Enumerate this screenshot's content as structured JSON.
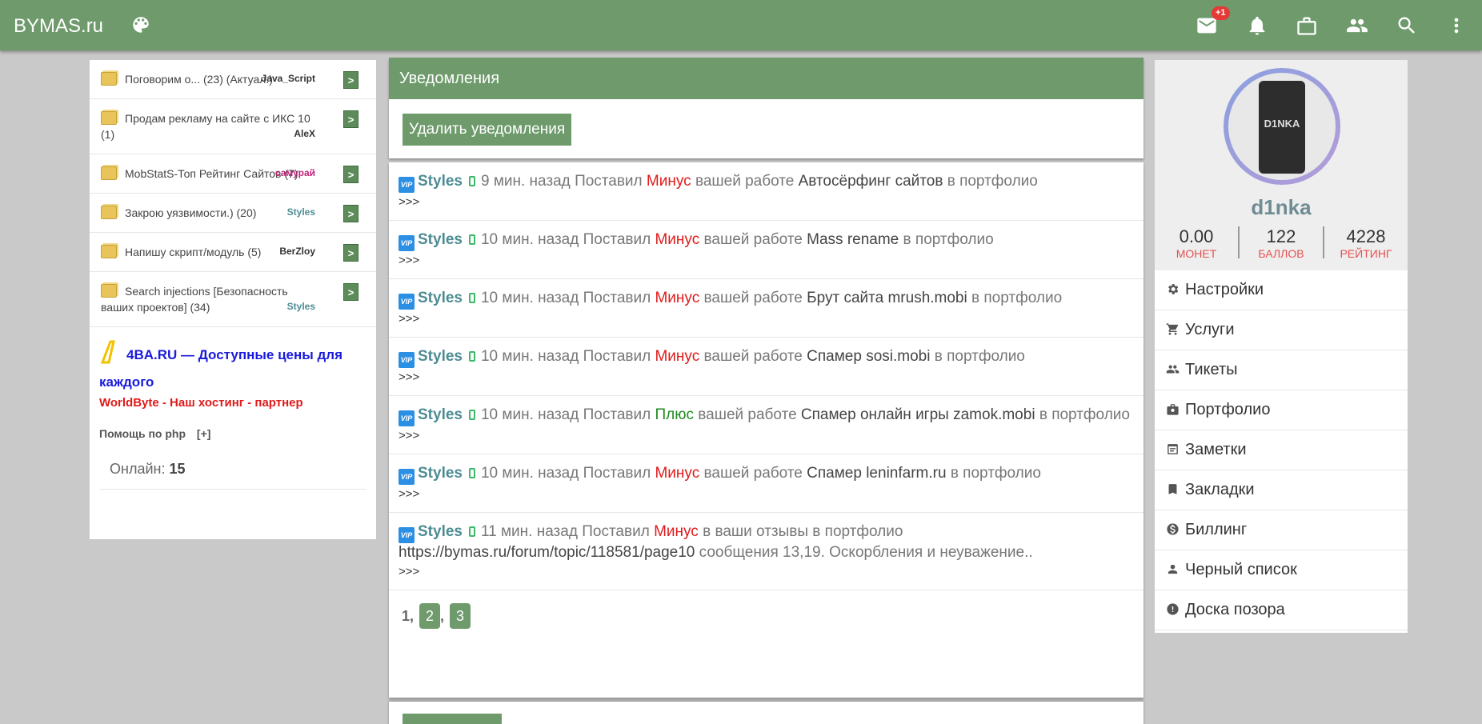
{
  "header": {
    "brand": "BYMAS.ru",
    "mail_badge": "+1",
    "icons": [
      "palette-icon",
      "mail-icon",
      "bell-icon",
      "briefcase-icon",
      "people-icon",
      "search-icon",
      "more-vert-icon"
    ]
  },
  "left": {
    "topics": [
      {
        "title": "Поговорим о... (23) (Актуал.)",
        "author": "Java_Script",
        "author_color": "#333333",
        "go": ">"
      },
      {
        "title": "Продам рекламу на сайте с ИКС 10 (1)",
        "author": "AleX",
        "author_color": "#333333",
        "go": ">"
      },
      {
        "title": "MobStatS-Топ Рейтинг Сайтов (7)",
        "author": "самурай",
        "author_color": "#c0237a",
        "go": ">"
      },
      {
        "title": "Закрою уязвимости.) (20)",
        "author": "Styles",
        "author_color": "#4e8c94",
        "go": ">"
      },
      {
        "title": "Напишу скрипт/модуль (5)",
        "author": "BerZloy",
        "author_color": "#333333",
        "go": ">"
      },
      {
        "title": "Search injections [Безопасность ваших проектов] (34)",
        "author": "Styles",
        "author_color": "#4e8c94",
        "go": ">"
      }
    ],
    "promo_line1": "4BA.RU — Доступные цены для каждого",
    "promo_line2": "WorldByte - Наш хостинг - партнер",
    "help_text": "Помощь по php",
    "help_plus": "[+]",
    "online_label": "Онлайн:",
    "online_count": "15"
  },
  "main": {
    "title": "Уведомления",
    "delete_button": "Удалить уведомления",
    "notifications": [
      {
        "user": "Styles",
        "time": "9 мин. назад",
        "verb": "Поставил",
        "action": "Минус",
        "action_type": "minus",
        "pre": "вашей работе",
        "work": "Автосёрфинг сайтов",
        "post": "в портфолио",
        "more": ">>>"
      },
      {
        "user": "Styles",
        "time": "10 мин. назад",
        "verb": "Поставил",
        "action": "Минус",
        "action_type": "minus",
        "pre": "вашей работе",
        "work": "Mass rename",
        "post": "в портфолио",
        "more": ">>>"
      },
      {
        "user": "Styles",
        "time": "10 мин. назад",
        "verb": "Поставил",
        "action": "Минус",
        "action_type": "minus",
        "pre": "вашей работе",
        "work": "Брут сайта mrush.mobi",
        "post": "в портфолио",
        "more": ">>>"
      },
      {
        "user": "Styles",
        "time": "10 мин. назад",
        "verb": "Поставил",
        "action": "Минус",
        "action_type": "minus",
        "pre": "вашей работе",
        "work": "Спамер sosi.mobi",
        "post": "в портфолио",
        "more": ">>>"
      },
      {
        "user": "Styles",
        "time": "10 мин. назад",
        "verb": "Поставил",
        "action": "Плюс",
        "action_type": "plus",
        "pre": "вашей работе",
        "work": "Спамер онлайн игры zamok.mobi",
        "post": "в портфолио",
        "more": ">>>"
      },
      {
        "user": "Styles",
        "time": "10 мин. назад",
        "verb": "Поставил",
        "action": "Минус",
        "action_type": "minus",
        "pre": "вашей работе",
        "work": "Спамер leninfarm.ru",
        "post": "в портфолио",
        "more": ">>>"
      },
      {
        "user": "Styles",
        "time": "11 мин. назад",
        "verb": "Поставил",
        "action": "Минус",
        "action_type": "minus",
        "pre": "в ваши отзывы в портфолио",
        "work": "https://bymas.ru/forum/topic/118581/page10",
        "post": "сообщения 13,19. Оскорбления и неуважение..",
        "more": ">>>"
      }
    ],
    "pager": {
      "current": "1",
      "pages": [
        "2",
        "3"
      ]
    }
  },
  "right": {
    "avatar_text": "D1NKA",
    "username": "d1nka",
    "stats": [
      {
        "value": "0.00",
        "label": "монет"
      },
      {
        "value": "122",
        "label": "баллов"
      },
      {
        "value": "4228",
        "label": "рейтинг"
      }
    ],
    "menu": [
      {
        "label": "Настройки",
        "icon": "gear-icon"
      },
      {
        "label": "Услуги",
        "icon": "cart-icon"
      },
      {
        "label": "Тикеты",
        "icon": "people-icon"
      },
      {
        "label": "Портфолио",
        "icon": "portfolio-icon"
      },
      {
        "label": "Заметки",
        "icon": "notes-icon"
      },
      {
        "label": "Закладки",
        "icon": "bookmark-icon"
      },
      {
        "label": "Биллинг",
        "icon": "billing-icon"
      },
      {
        "label": "Черный список",
        "icon": "person-icon"
      },
      {
        "label": "Доска позора",
        "icon": "alert-icon"
      }
    ]
  }
}
